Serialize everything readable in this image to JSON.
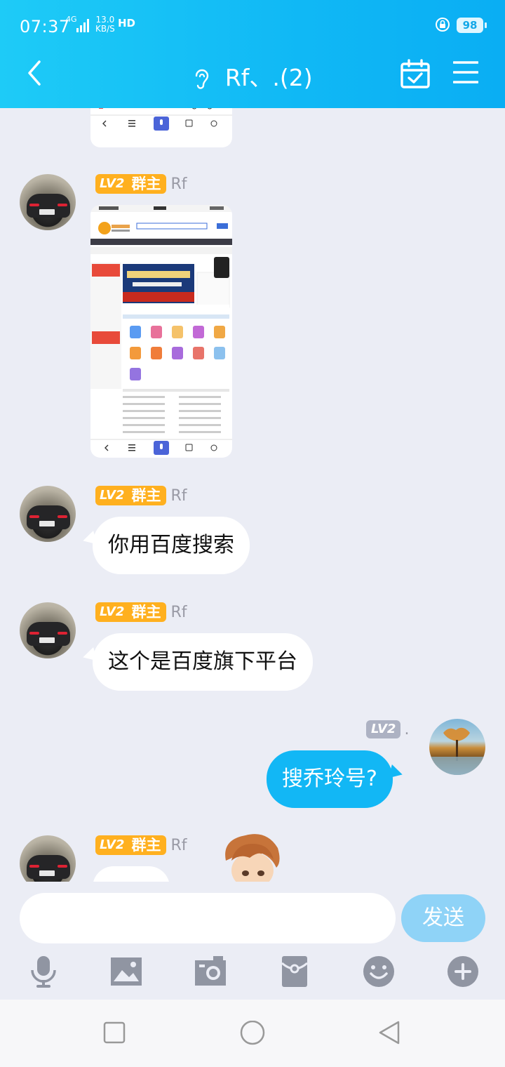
{
  "status_bar": {
    "time": "07:37",
    "network": "4G",
    "speed_value": "13.0",
    "speed_unit": "KB/S",
    "hd": "HD",
    "battery": "98"
  },
  "header": {
    "title": "Rf、.(2)",
    "accent": "#12b7f5"
  },
  "messages": [
    {
      "sender": "Rf",
      "level": "LV2",
      "role": "群主",
      "type": "image"
    },
    {
      "sender": "Rf",
      "level": "LV2",
      "role": "群主",
      "type": "text",
      "text": "你用百度搜索"
    },
    {
      "sender": "Rf",
      "level": "LV2",
      "role": "群主",
      "type": "text",
      "text": "这个是百度旗下平台"
    },
    {
      "sender": ".",
      "level": "LV2",
      "type": "text",
      "text": "搜乔玲号?"
    },
    {
      "sender": "Rf",
      "level": "LV2",
      "role": "群主",
      "type": "sticker"
    }
  ],
  "input": {
    "placeholder": "",
    "send_label": "发送"
  },
  "toolbar_icons": [
    "microphone-icon",
    "image-icon",
    "camera-icon",
    "red-packet-icon",
    "emoji-icon",
    "plus-icon"
  ]
}
